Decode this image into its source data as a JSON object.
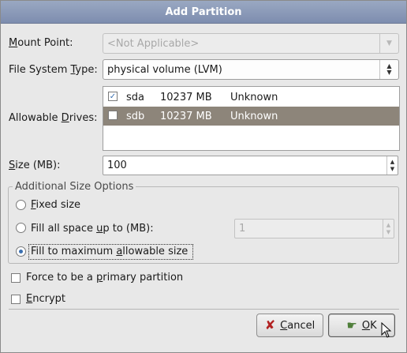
{
  "dialog": {
    "title": "Add Partition"
  },
  "mount_point": {
    "label_pre": "",
    "label_u": "M",
    "label_post": "ount Point:",
    "value": "<Not Applicable>"
  },
  "fs_type": {
    "label_pre": "File System ",
    "label_u": "T",
    "label_post": "ype:",
    "value": "physical volume (LVM)"
  },
  "drives": {
    "label_pre": "Allowable ",
    "label_u": "D",
    "label_post": "rives:",
    "rows": [
      {
        "checked": true,
        "name": "sda",
        "size": "10237 MB",
        "model": "Unknown"
      },
      {
        "checked": false,
        "name": "sdb",
        "size": "10237 MB",
        "model": "Unknown"
      }
    ]
  },
  "size": {
    "label_pre": "",
    "label_u": "S",
    "label_post": "ize (MB):",
    "value": "100"
  },
  "size_options": {
    "title": "Additional Size Options",
    "fixed": {
      "pre": "",
      "u": "F",
      "post": "ixed size",
      "selected": false
    },
    "fill_upto": {
      "pre": "Fill all space ",
      "u": "u",
      "post": "p to (MB):",
      "selected": false,
      "value": "1"
    },
    "fill_max": {
      "pre": "Fill to maximum ",
      "u": "a",
      "post": "llowable size",
      "selected": true
    }
  },
  "primary": {
    "pre": "Force to be a ",
    "u": "p",
    "post": "rimary partition",
    "checked": false
  },
  "encrypt": {
    "pre": "",
    "u": "E",
    "post": "ncrypt",
    "checked": false
  },
  "buttons": {
    "cancel": {
      "pre": "",
      "u": "C",
      "post": "ancel",
      "icon": "cancel-x-icon"
    },
    "ok": {
      "pre": "",
      "u": "O",
      "post": "K",
      "icon": "ok-hand-icon"
    }
  },
  "colors": {
    "title_bar": "#8797b8",
    "selection": "#8d857a",
    "accent": "#3a6fb0"
  }
}
